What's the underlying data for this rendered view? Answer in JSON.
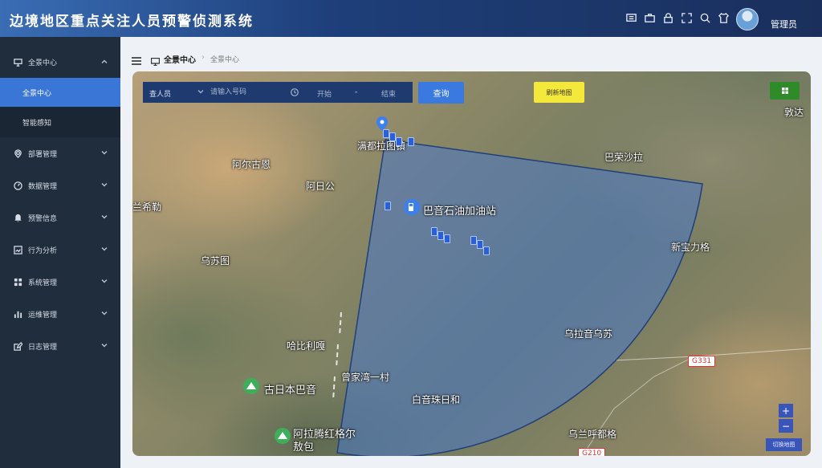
{
  "header": {
    "title": "边境地区重点关注人员预警侦测系统",
    "tools": [
      "screen-icon",
      "briefcase-icon",
      "lock-icon",
      "fullscreen-icon",
      "search-icon",
      "shirt-icon"
    ],
    "user": "管理员"
  },
  "sidebar": {
    "groups": [
      {
        "label": "全景中心",
        "icon": "monitor-icon",
        "expanded": true,
        "children": [
          "全景中心",
          "智能感知"
        ],
        "active_child": "全景中心"
      },
      {
        "label": "部署管理",
        "icon": "location-icon"
      },
      {
        "label": "数据管理",
        "icon": "dashboard-icon"
      },
      {
        "label": "预警信息",
        "icon": "bell-icon"
      },
      {
        "label": "行为分析",
        "icon": "analysis-icon"
      },
      {
        "label": "系统管理",
        "icon": "grid-icon"
      },
      {
        "label": "运维管理",
        "icon": "bar-chart-icon"
      },
      {
        "label": "日志管理",
        "icon": "edit-icon"
      }
    ]
  },
  "breadcrumb": {
    "current": "全景中心",
    "sub": "全景中心"
  },
  "search": {
    "type_label": "查人员",
    "placeholder": "请输入号码",
    "start": "开始",
    "separator": "-",
    "end": "结束",
    "query_button": "查询"
  },
  "map": {
    "refresh_button": "刷新地图",
    "switch_button": "切换地图",
    "zoom_in": "+",
    "zoom_out": "−",
    "places": [
      "敦达",
      "满都拉图镇",
      "巴荣沙拉",
      "阿尔古恩",
      "阿日公",
      "兰希勒",
      "巴音石油加油站",
      "乌苏图",
      "新宝力格",
      "乌拉音乌苏",
      "哈比利嘎",
      "曾家湾一村",
      "古日本巴音",
      "白音珠日和",
      "阿拉腾红格尔",
      "敖包",
      "乌兰呼都格"
    ],
    "roads": [
      "G331",
      "G210"
    ],
    "colors": {
      "sector_fill": "#4a78c8",
      "sector_stroke": "#1f3f7a",
      "query_button": "#3a7ae0",
      "refresh_button": "#f4e83a",
      "grid_button": "#2f8a2a"
    }
  }
}
